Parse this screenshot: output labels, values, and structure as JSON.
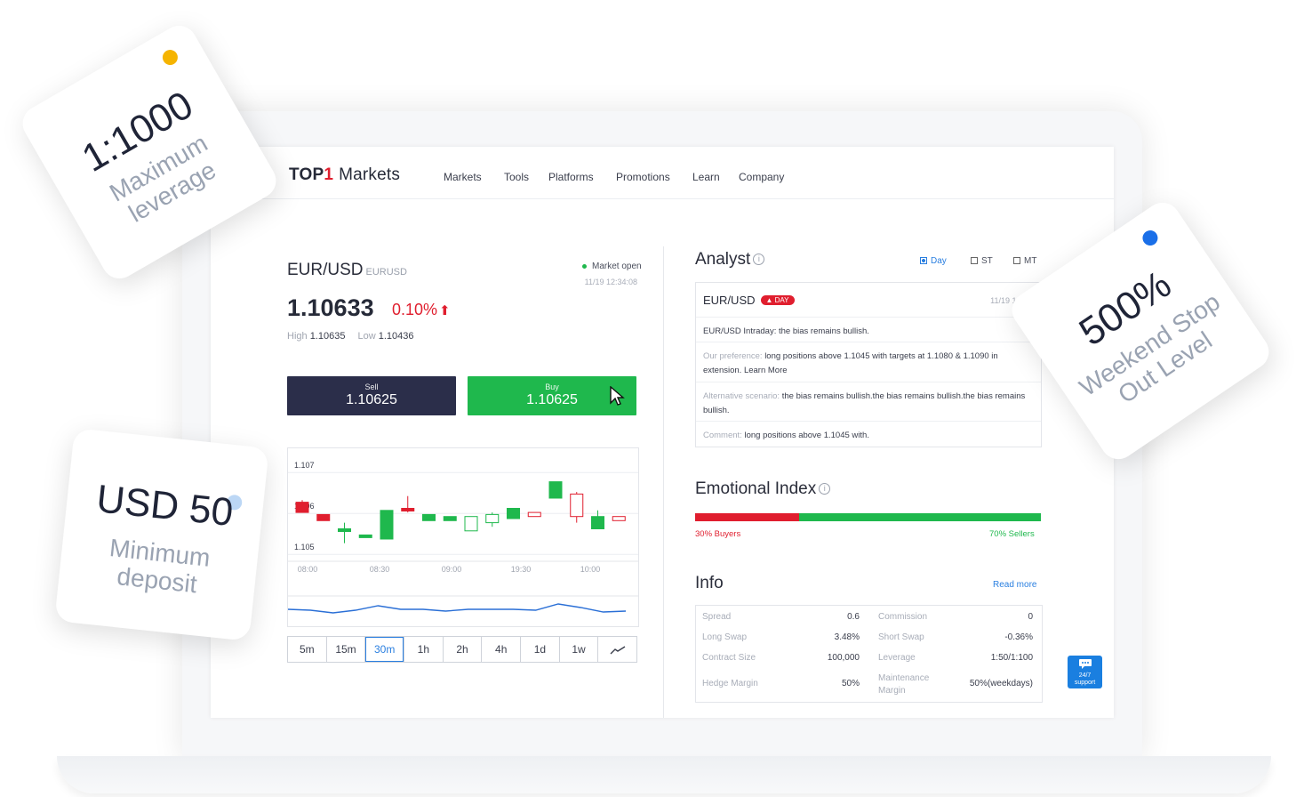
{
  "header": {
    "logo_prefix": "TOP",
    "logo_digit": "1",
    "logo_suffix": "Markets",
    "nav": [
      "Markets",
      "Tools",
      "Platforms",
      "Promotions",
      "Learn",
      "Company"
    ]
  },
  "quote": {
    "pair": "EUR/USD",
    "symbol": "EURUSD",
    "status": "Market open",
    "timestamp": "11/19 12:34:08",
    "price": "1.10633",
    "change": "0.10%",
    "high_label": "High",
    "high": "1.10635",
    "low_label": "Low",
    "low": "1.10436",
    "sell_label": "Sell",
    "sell_price": "1.10625",
    "buy_label": "Buy",
    "buy_price": "1.10625"
  },
  "chart_data": {
    "type": "candlestick",
    "title": "",
    "y_ticks": [
      "1.107",
      "1.106",
      "1.105"
    ],
    "x_ticks": [
      "08:00",
      "08:30",
      "09:00",
      "19:30",
      "10:00"
    ],
    "candles": [
      {
        "open": 1.1061,
        "close": 1.10585,
        "high": 1.10615,
        "low": 1.10585,
        "dir": "down"
      },
      {
        "open": 1.1058,
        "close": 1.10565,
        "high": 1.1058,
        "low": 1.10565,
        "dir": "down"
      },
      {
        "open": 1.1054,
        "close": 1.10545,
        "high": 1.1056,
        "low": 1.1051,
        "dir": "up"
      },
      {
        "open": 1.10525,
        "close": 1.1053,
        "high": 1.1053,
        "low": 1.10525,
        "dir": "up"
      },
      {
        "open": 1.1052,
        "close": 1.1059,
        "high": 1.1059,
        "low": 1.1052,
        "dir": "up"
      },
      {
        "open": 1.1059,
        "close": 1.10595,
        "high": 1.10625,
        "low": 1.10585,
        "dir": "down"
      },
      {
        "open": 1.10565,
        "close": 1.1058,
        "high": 1.1058,
        "low": 1.10565,
        "dir": "up"
      },
      {
        "open": 1.10565,
        "close": 1.10575,
        "high": 1.10575,
        "low": 1.10565,
        "dir": "up"
      },
      {
        "open": 1.1054,
        "close": 1.10575,
        "high": 1.10575,
        "low": 1.1054,
        "dir": "up-hollow"
      },
      {
        "open": 1.1056,
        "close": 1.1058,
        "high": 1.10585,
        "low": 1.1055,
        "dir": "up-hollow"
      },
      {
        "open": 1.1057,
        "close": 1.10595,
        "high": 1.10595,
        "low": 1.1057,
        "dir": "up"
      },
      {
        "open": 1.10585,
        "close": 1.10575,
        "high": 1.10585,
        "low": 1.10575,
        "dir": "down-hollow"
      },
      {
        "open": 1.1062,
        "close": 1.1066,
        "high": 1.1066,
        "low": 1.1062,
        "dir": "up"
      },
      {
        "open": 1.1063,
        "close": 1.10575,
        "high": 1.10635,
        "low": 1.1056,
        "dir": "down-hollow"
      },
      {
        "open": 1.10575,
        "close": 1.10545,
        "high": 1.1059,
        "low": 1.10545,
        "dir": "up"
      },
      {
        "open": 1.10575,
        "close": 1.10565,
        "high": 1.10575,
        "low": 1.10565,
        "dir": "down-hollow"
      }
    ],
    "mini_line": [
      0.55,
      0.5,
      0.35,
      0.5,
      0.75,
      0.55,
      0.55,
      0.45,
      0.55,
      0.55,
      0.55,
      0.5,
      0.85,
      0.65,
      0.4,
      0.45
    ]
  },
  "timeframes": [
    "5m",
    "15m",
    "30m",
    "1h",
    "2h",
    "4h",
    "1d",
    "1w"
  ],
  "active_timeframe": "30m",
  "analyst": {
    "title": "Analyst",
    "options": [
      "Day",
      "ST",
      "MT"
    ],
    "pair": "EUR/USD",
    "tag": "DAY",
    "timestamp": "11/19 12:30",
    "intraday": "EUR/USD Intraday: the bias remains bullish.",
    "preference_label": "Our preference:",
    "preference": "long positions above 1.1045 with targets at 1.1080 & 1.1090 in extension. Learn More",
    "alternative_label": "Alternative scenario:",
    "alternative": "the bias remains bullish.the bias remains bullish.the bias remains bullish.",
    "comment_label": "Comment:",
    "comment": "long positions above 1.1045 with."
  },
  "emotional": {
    "title": "Emotional Index",
    "buyers": "30% Buyers",
    "sellers": "70% Sellers",
    "buyers_pct": 30
  },
  "info": {
    "title": "Info",
    "read_more": "Read more",
    "rows": [
      {
        "k1": "Spread",
        "v1": "0.6",
        "k2": "Commission",
        "v2": "0"
      },
      {
        "k1": "Long Swap",
        "v1": "3.48%",
        "k2": "Short Swap",
        "v2": "-0.36%"
      },
      {
        "k1": "Contract Size",
        "v1": "100,000",
        "k2": "Leverage",
        "v2": "1:50/1:100"
      },
      {
        "k1": "Hedge Margin",
        "v1": "50%",
        "k2": "Maintenance Margin",
        "v2": "50%(weekdays)"
      }
    ]
  },
  "support": {
    "line1": "24/7",
    "line2": "support"
  },
  "promos": [
    {
      "big": "1:1000",
      "small1": "Maximum",
      "small2": "leverage",
      "dot_color": "#f5b400"
    },
    {
      "big": "USD 50",
      "small1": "Minimum",
      "small2": "deposit",
      "dot_color": "#bcd7f5"
    },
    {
      "big": "500%",
      "small1": "Weekend Stop",
      "small2": "Out Level",
      "dot_color": "#1a6fe8"
    }
  ],
  "colors": {
    "up": "#1fb84d",
    "down": "#e01e2e",
    "accent": "#2a7fe0",
    "dark": "#2b2e4a"
  }
}
